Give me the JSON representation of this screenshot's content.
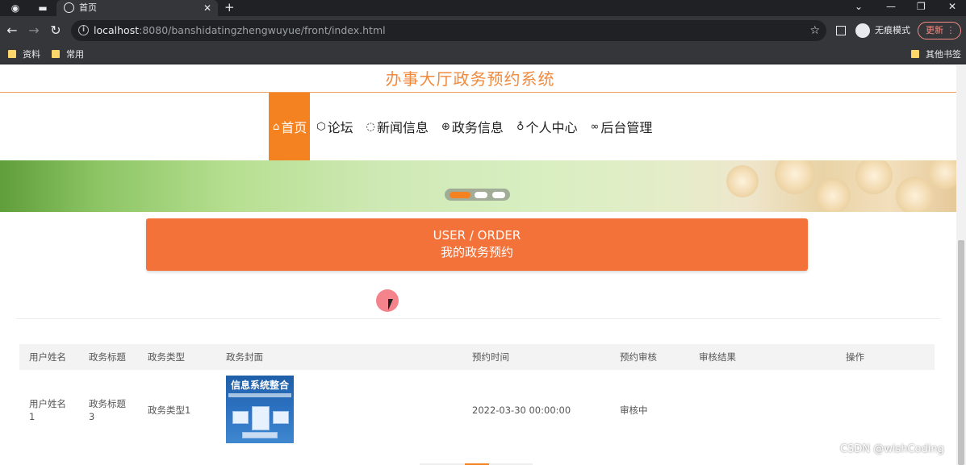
{
  "browser": {
    "tab_title": "首页",
    "tab_close": "✕",
    "new_tab": "+",
    "url_host": "localhost",
    "url_path": ":8080/banshidatingzhengwuyue/front/index.html",
    "incognito_label": "无痕模式",
    "update_label": "更新",
    "bookmarks": [
      "资料",
      "常用"
    ],
    "other_bookmarks": "其他书签"
  },
  "site": {
    "title": "办事大厅政务预约系统"
  },
  "nav": {
    "items": [
      {
        "label": "首页",
        "icon": "home-icon",
        "glyph": "⌂"
      },
      {
        "label": "论坛",
        "icon": "cube-icon",
        "glyph": "⬡"
      },
      {
        "label": "新闻信息",
        "icon": "chat-icon",
        "glyph": "◌"
      },
      {
        "label": "政务信息",
        "icon": "globe-icon",
        "glyph": "⊕"
      },
      {
        "label": "个人中心",
        "icon": "user-icon",
        "glyph": "♁"
      },
      {
        "label": "后台管理",
        "icon": "link-icon",
        "glyph": "∞"
      }
    ]
  },
  "banner": {
    "slides": 3,
    "active_slide": 0
  },
  "order_section": {
    "title_en": "USER / ORDER",
    "title_cn": "我的政务预约"
  },
  "table": {
    "headers": [
      "用户姓名",
      "政务标题",
      "政务类型",
      "政务封面",
      "预约时间",
      "预约审核",
      "审核结果",
      "操作"
    ],
    "rows": [
      {
        "user_name": "用户姓名1",
        "gov_title": "政务标题3",
        "gov_type": "政务类型1",
        "cover_title": "信息系统整合",
        "time": "2022-03-30 00:00:00",
        "review": "审核中",
        "result": "",
        "action": ""
      }
    ]
  },
  "watermark": "CSDN @wishCoding"
}
